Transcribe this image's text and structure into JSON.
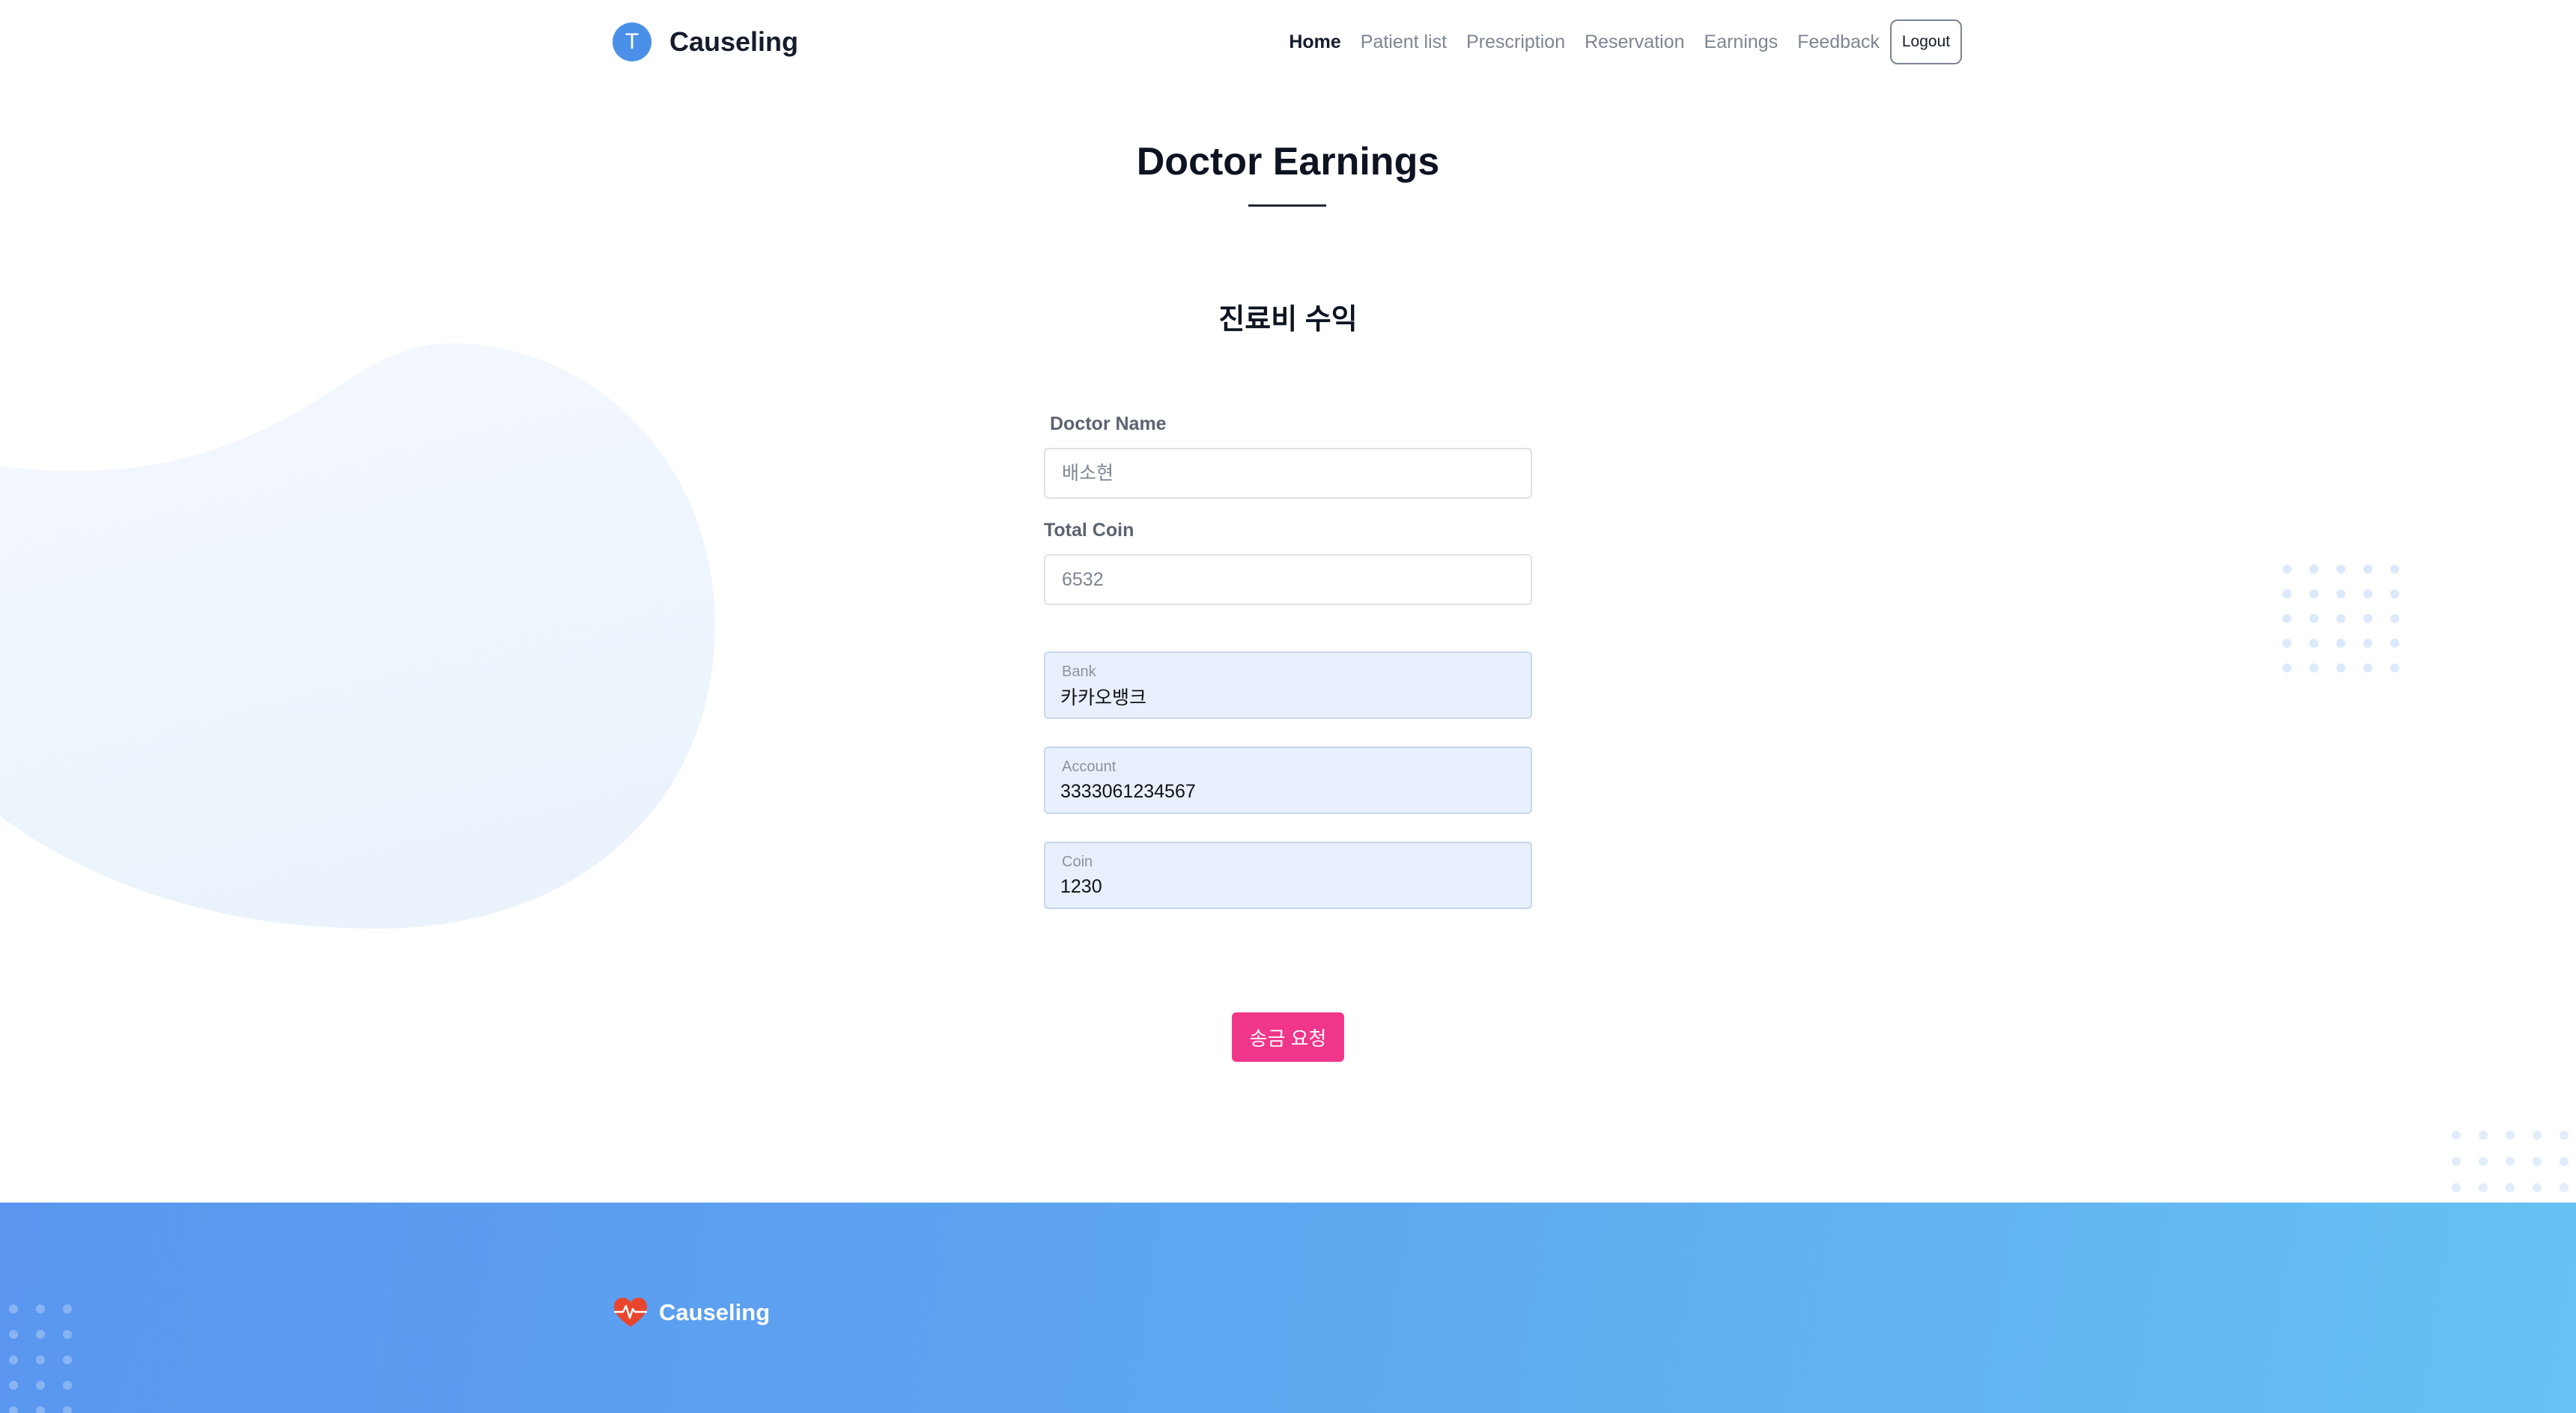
{
  "app": {
    "brand_initial": "T",
    "brand_name": "Causeling"
  },
  "nav": {
    "items": [
      {
        "label": "Home",
        "active": true
      },
      {
        "label": "Patient list",
        "active": false
      },
      {
        "label": "Prescription",
        "active": false
      },
      {
        "label": "Reservation",
        "active": false
      },
      {
        "label": "Earnings",
        "active": false
      },
      {
        "label": "Feedback",
        "active": false
      }
    ],
    "logout_label": "Logout"
  },
  "page": {
    "title": "Doctor Earnings",
    "section_title": "진료비 수익"
  },
  "form": {
    "doctor_name": {
      "label": "Doctor Name",
      "placeholder": "배소현"
    },
    "total_coin": {
      "label": "Total Coin",
      "placeholder": "6532"
    },
    "bank": {
      "label": "Bank",
      "value": "카카오뱅크"
    },
    "account": {
      "label": "Account",
      "value": "3333061234567"
    },
    "coin": {
      "label": "Coin",
      "value": "1230"
    },
    "submit_label": "송금 요청"
  },
  "footer": {
    "logo_icon": "heart-pulse-icon",
    "brand_name": "Causeling"
  },
  "colors": {
    "primary": "#4a90e8",
    "accent": "#f0368a",
    "footer_gradient_start": "#5a96ef",
    "footer_gradient_end": "#66c2f2",
    "autofill_bg": "#e8f0fe"
  }
}
